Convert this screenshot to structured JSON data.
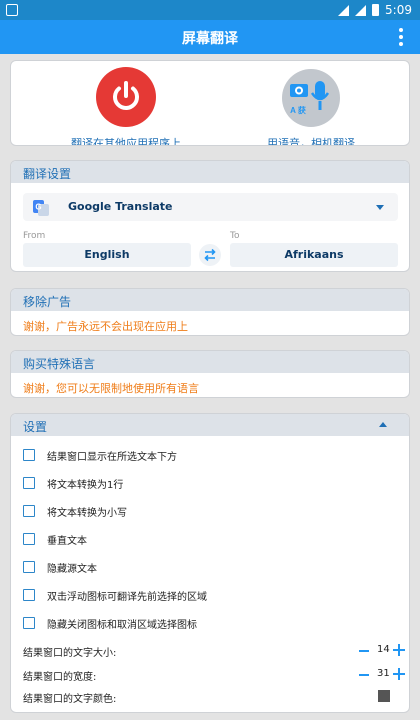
{
  "statusbar": {
    "time": "5:09"
  },
  "appbar": {
    "title": "屏幕翻译"
  },
  "actions": {
    "translate_other_apps": "翻译在其他应用程序上",
    "voice_camera": "用语音，相机翻译",
    "cam_letters": "A 获"
  },
  "translation_settings": {
    "header": "翻译设置",
    "engine_icon_text": "G",
    "engine": "Google Translate",
    "from_label": "From",
    "from_value": "English",
    "to_label": "To",
    "to_value": "Afrikaans"
  },
  "remove_ads": {
    "header": "移除广告",
    "note": "谢谢，广告永远不会出现在应用上"
  },
  "buy_languages": {
    "header": "购买特殊语言",
    "note": "谢谢，您可以无限制地使用所有语言"
  },
  "settings": {
    "header": "设置",
    "options": [
      "结果窗口显示在所选文本下方",
      "将文本转换为1行",
      "将文本转换为小写",
      "垂直文本",
      "隐藏源文本",
      "双击浮动图标可翻译先前选择的区域",
      "隐藏关闭图标和取消区域选择图标"
    ],
    "font_size_label": "结果窗口的文字大小:",
    "font_size_value": "14",
    "width_label": "结果窗口的宽度:",
    "width_value": "31",
    "color_label": "结果窗口的文字颜色:",
    "text_color": "#555555"
  },
  "colors": {
    "appbar": "#2196f3",
    "statusbar": "#1d87c9",
    "accent": "#1f6fb5",
    "warning": "#ef7d19",
    "power": "#e53935"
  }
}
